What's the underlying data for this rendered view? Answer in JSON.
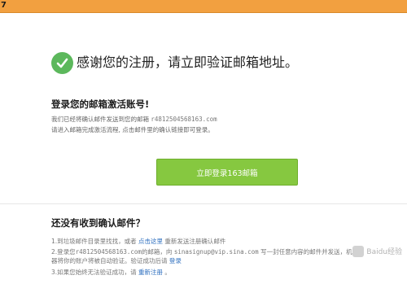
{
  "topbar": {
    "fragment": "7"
  },
  "hero": {
    "title": "感谢您的注册，请立即验证邮箱地址。"
  },
  "activate": {
    "heading": "登录您的邮箱激活账号!",
    "line1_prefix": "我们已经将确认邮件发送到您的邮箱 ",
    "line1_email": "r4812504568163.com",
    "line2": "请进入邮箱完成激活流程, 点击邮件里的确认链接即可登录。",
    "button_label": "立即登录163邮箱"
  },
  "help": {
    "heading": "还没有收到确认邮件？",
    "item1_prefix": "1.到垃圾邮件目录里找找，或者 ",
    "item1_link": "点击这里",
    "item1_suffix": " 重新发送注册确认邮件",
    "item2a_prefix": "2.登录您",
    "item2a_email": "r4812504568163.com",
    "item2a_mid": "的邮箱，向 ",
    "item2a_addr": "sinasignup@vip.sina.com",
    "item2a_suffix": " 写一封任意内容的邮件并发送，机",
    "item2b_prefix": "  器将你的账户将被自动验证。验证成功后请 ",
    "item2b_link": "登录",
    "item3_prefix": "3.如果您始终无法验证成功，请 ",
    "item3_link": "重新注册",
    "item3_suffix": " 。"
  },
  "watermark": {
    "text": "Baidu经验"
  }
}
